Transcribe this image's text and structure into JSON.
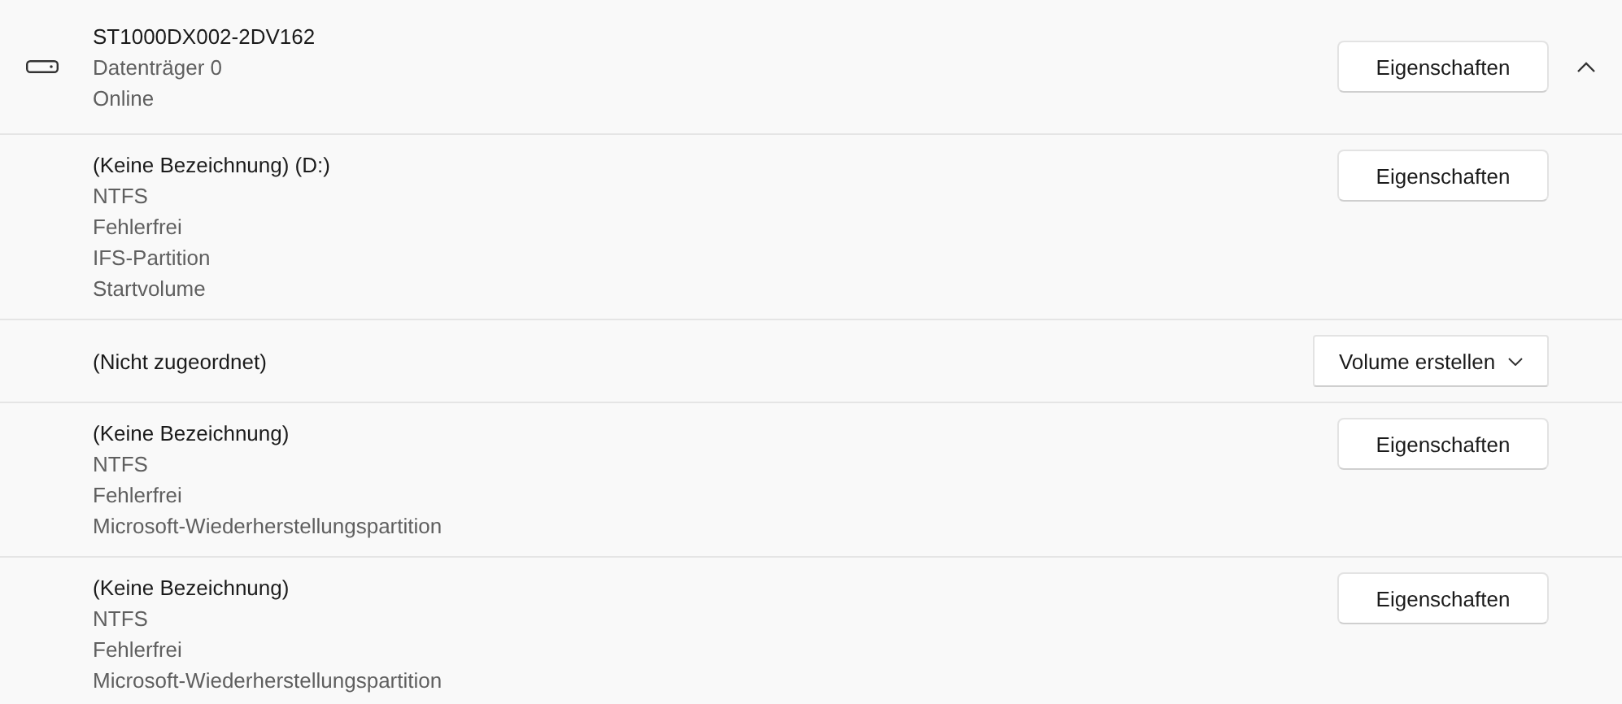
{
  "disk": {
    "model": "ST1000DX002-2DV162",
    "number": "Datenträger 0",
    "status": "Online",
    "button": "Eigenschaften",
    "expanded": true
  },
  "volumes": [
    {
      "kind": "partition",
      "title": "(Keine Bezeichnung) (D:)",
      "details": [
        "NTFS",
        "Fehlerfrei",
        "IFS-Partition",
        "Startvolume"
      ],
      "button": "Eigenschaften"
    },
    {
      "kind": "unallocated",
      "title": "(Nicht zugeordnet)",
      "button": "Volume erstellen"
    },
    {
      "kind": "partition",
      "title": "(Keine Bezeichnung)",
      "details": [
        "NTFS",
        "Fehlerfrei",
        "Microsoft-Wiederherstellungspartition"
      ],
      "button": "Eigenschaften"
    },
    {
      "kind": "partition",
      "title": "(Keine Bezeichnung)",
      "details": [
        "NTFS",
        "Fehlerfrei",
        "Microsoft-Wiederherstellungspartition"
      ],
      "button": "Eigenschaften"
    }
  ]
}
